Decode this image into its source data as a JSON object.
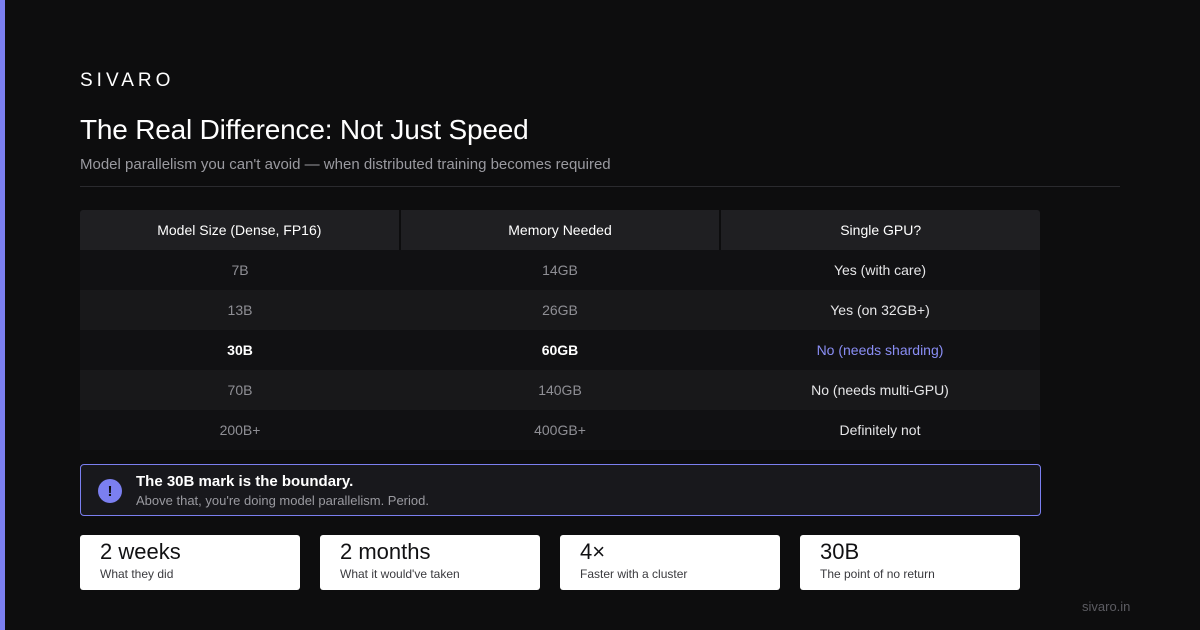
{
  "brand": "SIVARO",
  "title": "The Real Difference: Not Just Speed",
  "subtitle": "Model parallelism you can't avoid — when distributed training becomes required",
  "table": {
    "headers": [
      "Model Size (Dense, FP16)",
      "Memory Needed",
      "Single GPU?"
    ],
    "rows": [
      [
        "7B",
        "14GB",
        "Yes (with care)"
      ],
      [
        "13B",
        "26GB",
        "Yes (on 32GB+)"
      ],
      [
        "30B",
        "60GB",
        "No (needs sharding)"
      ],
      [
        "70B",
        "140GB",
        "No (needs multi-GPU)"
      ],
      [
        "200B+",
        "400GB+",
        "Definitely not"
      ]
    ],
    "highlight_row": 2
  },
  "callout": {
    "icon": "exclamation-icon",
    "glyph": "!",
    "title": "The 30B mark is the boundary.",
    "text": "Above that, you're doing model parallelism. Period."
  },
  "stats": [
    {
      "value": "2 weeks",
      "label": "What they did"
    },
    {
      "value": "2 months",
      "label": "What it would've taken"
    },
    {
      "value": "4×",
      "label": "Faster with a cluster"
    },
    {
      "value": "30B",
      "label": "The point of no return"
    }
  ],
  "footer": "sivaro.in",
  "colors": {
    "accent": "#7b7ff0",
    "background": "#0d0d0e",
    "highlight_text": "#8a8ef5"
  }
}
